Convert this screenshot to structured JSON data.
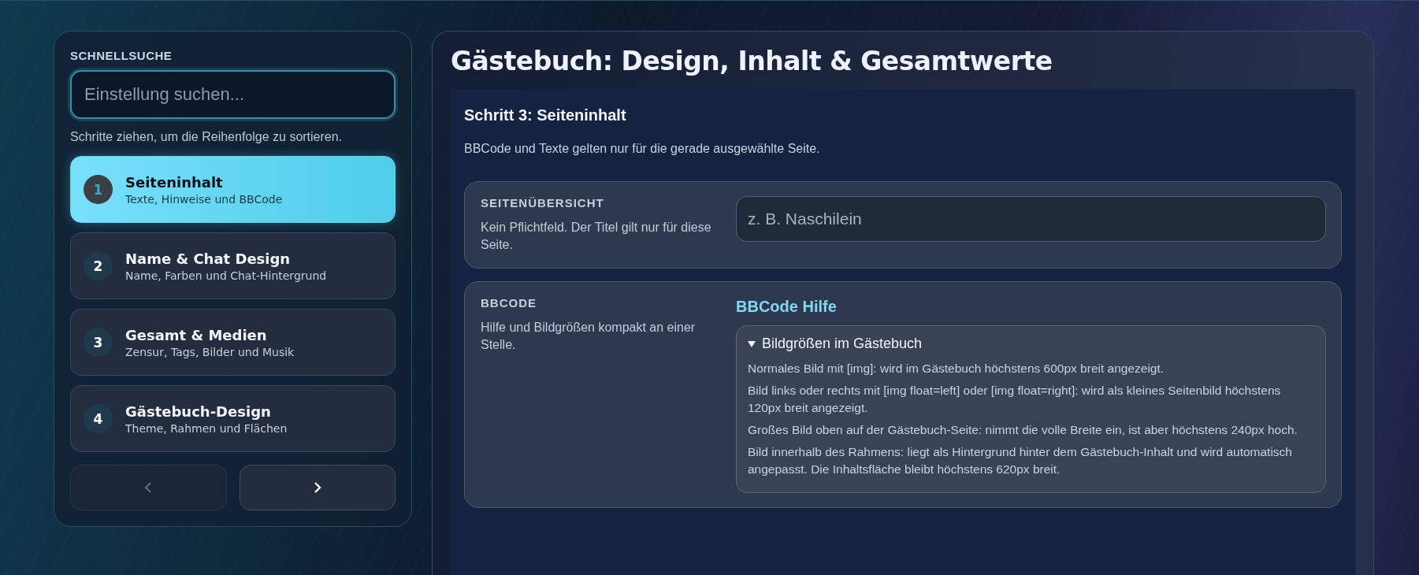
{
  "sidebar": {
    "heading": "SCHNELLSUCHE",
    "search": {
      "placeholder": "Einstellung suchen..."
    },
    "hint": "Schritte ziehen, um die Reihenfolge zu sortieren.",
    "steps": [
      {
        "number": "1",
        "title": "Seiteninhalt",
        "subtitle": "Texte, Hinweise und BBCode",
        "selected": true
      },
      {
        "number": "2",
        "title": "Name & Chat Design",
        "subtitle": "Name, Farben und Chat-Hintergrund",
        "selected": false
      },
      {
        "number": "3",
        "title": "Gesamt & Medien",
        "subtitle": "Zensur, Tags, Bilder und Musik",
        "selected": false
      },
      {
        "number": "4",
        "title": "Gästebuch-Design",
        "subtitle": "Theme, Rahmen und Flächen",
        "selected": false
      }
    ],
    "nav": [
      {
        "kind": "previous",
        "disabled": true
      },
      {
        "kind": "next",
        "disabled": false
      }
    ]
  },
  "main": {
    "title": "Gästebuch: Design, Inhalt & Gesamtwerte",
    "step_heading": "Schritt 3: Seiteninhalt",
    "step_description": "BBCode und Texte gelten nur für die gerade ausgewählte Seite.",
    "sections": [
      {
        "kind": "field",
        "heading": "SEITENÜBERSICHT",
        "description": "Kein Pflichtfeld. Der Titel gilt nur für diese Seite.",
        "placeholder": "z. B. Naschilein"
      },
      {
        "kind": "help",
        "heading": "BBCODE",
        "description": "Hilfe und Bildgrößen kompakt an einer Stelle.",
        "link": "BBCode Hilfe",
        "details": {
          "summary": "Bildgrößen im Gästebuch",
          "expanded": true,
          "lines": [
            "Normales Bild mit [img]: wird im Gästebuch höchstens 600px breit angezeigt.",
            "Bild links oder rechts mit [img float=left] oder [img float=right]: wird als kleines Seitenbild höchstens 120px breit angezeigt.",
            "Großes Bild oben auf der Gästebuch-Seite: nimmt die volle Breite ein, ist aber höchstens 240px hoch.",
            "Bild innerhalb des Rahmens: liegt als Hintergrund hinter dem Gästebuch-Inhalt und wird automatisch angepasst. Die Inhaltsfläche bleibt höchstens 620px breit."
          ]
        }
      }
    ]
  }
}
